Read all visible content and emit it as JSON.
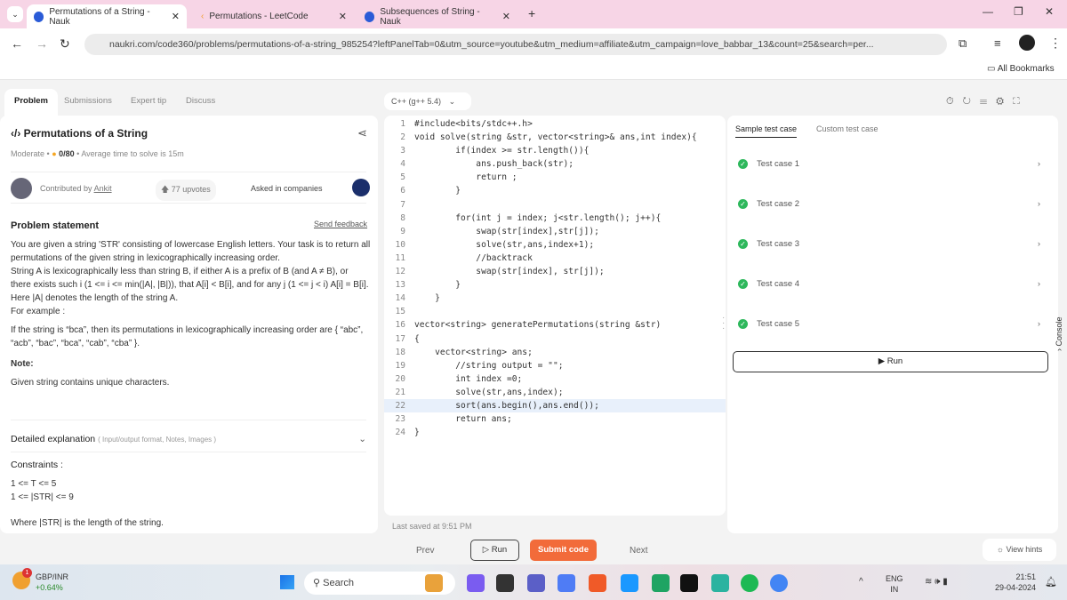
{
  "browser": {
    "tabs": [
      {
        "title": "Permutations of a String - Nauk",
        "color": "#2a5bd7"
      },
      {
        "title": "Permutations - LeetCode",
        "color": "#f0a030"
      },
      {
        "title": "Subsequences of String - Nauk",
        "color": "#2a5bd7"
      }
    ],
    "url": "naukri.com/code360/problems/permutations-of-a-string_985254?leftPanelTab=0&utm_source=youtube&utm_medium=affiliate&utm_campaign=love_babbar_13&count=25&search=per...",
    "bookmarks_label": "All Bookmarks"
  },
  "left": {
    "tabs": [
      "Problem",
      "Submissions",
      "Expert tip",
      "Discuss"
    ],
    "title": "Permutations of a String",
    "difficulty": "Moderate",
    "score": "0/80",
    "avg_time": "Average time to solve is 15m",
    "contributed_by": "Contributed by",
    "author": "Ankit",
    "upvotes": "77 upvotes",
    "asked_in": "Asked in companies",
    "statement_heading": "Problem statement",
    "send_feedback": "Send feedback",
    "p1": "You are given a string 'STR' consisting of lowercase English letters. Your task is to return all permutations of the given string in lexicographically increasing order.",
    "p2": "String A is lexicographically less than string B, if either A is a prefix of B (and A ≠ B), or there exists such i (1 <= i <= min(|A|, |B|)), that A[i] < B[i], and for any j (1 <= j < i) A[i] = B[i]. Here |A| denotes the length of the string A.",
    "p3": "For example :",
    "p4": "If the string is “bca”, then its permutations in lexicographically increasing order are { “abc”, “acb”, “bac”, “bca”, “cab”, “cba” }.",
    "note_heading": "Note:",
    "note": "Given string contains unique characters.",
    "detailed": "Detailed explanation",
    "detailed_sub": "( Input/output format, Notes, Images )",
    "constraints_heading": "Constraints :",
    "c1": "1 <= T <= 5",
    "c2": "1 <= |STR| <= 9",
    "c3": "Where |STR| is the length of the string."
  },
  "editor": {
    "language": "C++ (g++ 5.4)",
    "last_saved": "Last saved at 9:51 PM",
    "highlight_line": 22,
    "lines": [
      "#include<bits/stdc++.h>",
      "void solve(string &str, vector<string>& ans,int index){",
      "        if(index >= str.length()){",
      "            ans.push_back(str);",
      "            return ;",
      "        }",
      "",
      "        for(int j = index; j<str.length(); j++){",
      "            swap(str[index],str[j]);",
      "            solve(str,ans,index+1);",
      "            //backtrack",
      "            swap(str[index], str[j]);",
      "        }",
      "    }",
      "",
      "vector<string> generatePermutations(string &str)",
      "{",
      "    vector<string> ans;",
      "        //string output = \"\";",
      "        int index =0;",
      "        solve(str,ans,index);",
      "        sort(ans.begin(),ans.end());",
      "        return ans;",
      "}"
    ]
  },
  "right": {
    "tabs": [
      "Sample test case",
      "Custom test case"
    ],
    "cases": [
      "Test case 1",
      "Test case 2",
      "Test case 3",
      "Test case 4",
      "Test case 5"
    ],
    "run": "Run",
    "console": "Console"
  },
  "bottom": {
    "prev": "Prev",
    "run": "Run",
    "submit": "Submit code",
    "next": "Next",
    "hints": "View hints",
    "accent": "#f26b3a"
  },
  "taskbar": {
    "ticker": "GBP/INR",
    "change": "+0.64%",
    "badge": "1",
    "search": "Search",
    "lang1": "ENG",
    "lang2": "IN",
    "time": "21:51",
    "date": "29-04-2024"
  }
}
